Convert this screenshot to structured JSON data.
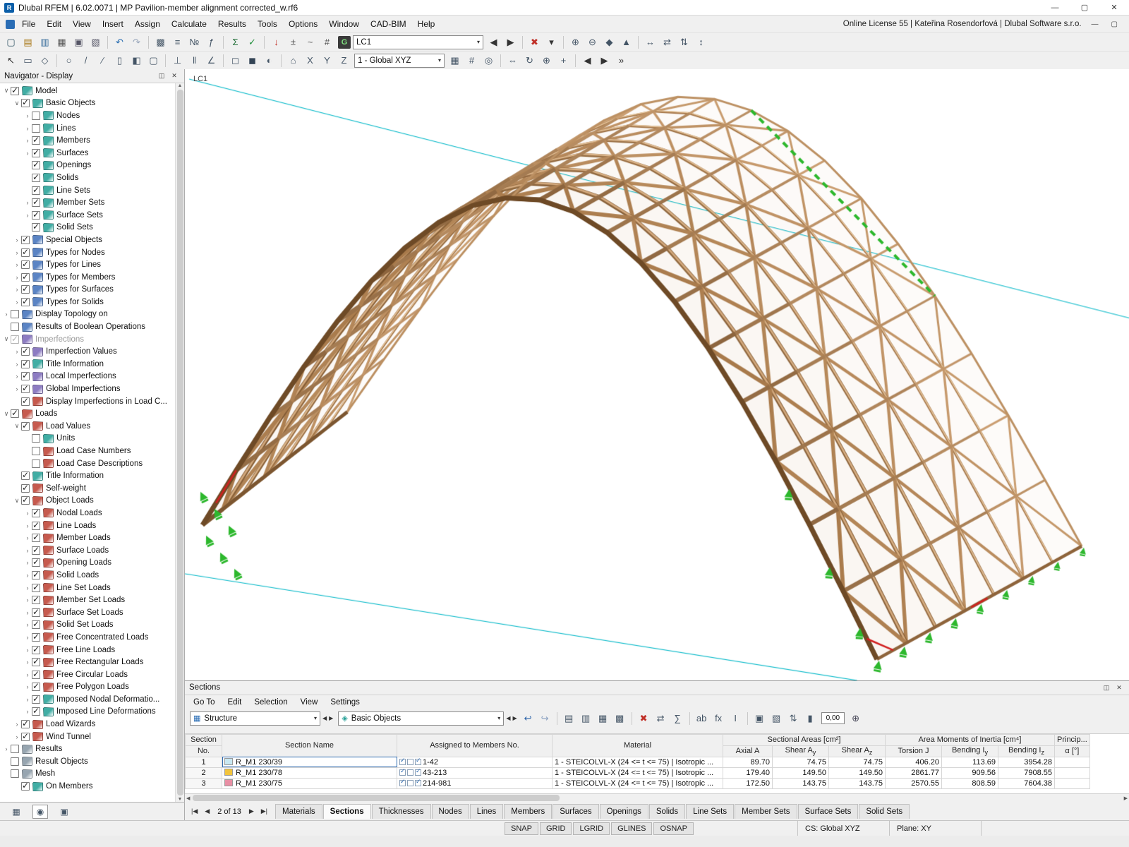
{
  "window": {
    "title": "Dlubal RFEM | 6.02.0071 | MP Pavilion-member alignment corrected_w.rf6"
  },
  "menu": {
    "items": [
      "File",
      "Edit",
      "View",
      "Insert",
      "Assign",
      "Calculate",
      "Results",
      "Tools",
      "Options",
      "Window",
      "CAD-BIM",
      "Help"
    ],
    "license": "Online License 55 | Kateřina Rosendorfová | Dlubal Software s.r.o."
  },
  "toolbar1": {
    "before": [
      [
        "new-model-icon",
        "▢",
        "#356"
      ],
      [
        "open-file-icon",
        "▤",
        "#a87818"
      ],
      [
        "save-file-icon",
        "▥",
        "#336a99"
      ],
      [
        "print-icon",
        "▦",
        "#555"
      ],
      [
        "copy-icon",
        "▣",
        "#556"
      ],
      [
        "screenshot-icon",
        "▧",
        "#556"
      ],
      [
        "sep"
      ],
      [
        "undo-icon",
        "↶",
        "#246ab0"
      ],
      [
        "redo-icon",
        "↷",
        "#95a3b9"
      ],
      [
        "sep"
      ],
      [
        "table-manager-icon",
        "▩",
        "#456"
      ],
      [
        "list-icon",
        "≡",
        "#456"
      ],
      [
        "renumber-icon",
        "№",
        "#456"
      ],
      [
        "generate-icon",
        "ƒ",
        "#456"
      ],
      [
        "sep"
      ],
      [
        "calculate-all-icon",
        "Σ",
        "#1f6e37"
      ],
      [
        "check-model-icon",
        "✓",
        "#1f8e3a"
      ],
      [
        "sep"
      ],
      [
        "new-load-icon",
        "↓",
        "#c03028"
      ],
      [
        "load-combination-icon",
        "±",
        "#555"
      ],
      [
        "imperfection-icon",
        "~",
        "#555"
      ],
      [
        "grid-icon",
        "#",
        "#555"
      ]
    ],
    "g_label": "G",
    "load_case": "LC1",
    "after": [
      [
        "prev-load-case-icon",
        "◀",
        "#333"
      ],
      [
        "next-load-case-icon",
        "▶",
        "#333"
      ],
      [
        "sep"
      ],
      [
        "delete-results-icon",
        "✖",
        "#c03028"
      ],
      [
        "delete-dropdown-icon",
        "▾",
        "#333"
      ],
      [
        "sep"
      ],
      [
        "zoom-in-icon",
        "⊕",
        "#456"
      ],
      [
        "zoom-out-icon",
        "⊖",
        "#456"
      ],
      [
        "node-snap-icon",
        "◆",
        "#456"
      ],
      [
        "member-snap-icon",
        "▲",
        "#456"
      ],
      [
        "sep"
      ],
      [
        "move-icon",
        "↔",
        "#456"
      ],
      [
        "swap-icon",
        "⇄",
        "#456"
      ],
      [
        "flip-icon",
        "⇅",
        "#456"
      ],
      [
        "measure-icon",
        "↕",
        "#456"
      ]
    ]
  },
  "toolbar2": {
    "before": [
      [
        "select-arrow-icon",
        "↖",
        "#333"
      ],
      [
        "select-window-icon",
        "▭",
        "#456"
      ],
      [
        "deselect-icon",
        "◇",
        "#456"
      ],
      [
        "sep"
      ],
      [
        "new-node-icon",
        "○",
        "#456"
      ],
      [
        "new-line-icon",
        "/",
        "#456"
      ],
      [
        "new-member-icon",
        "∕",
        "#456"
      ],
      [
        "new-surface-icon",
        "▯",
        "#456"
      ],
      [
        "new-solid-icon",
        "◧",
        "#456"
      ],
      [
        "new-opening-icon",
        "▢",
        "#456"
      ],
      [
        "sep"
      ],
      [
        "support-icon",
        "⊥",
        "#456"
      ],
      [
        "hinge-icon",
        "‖",
        "#456"
      ],
      [
        "dimension-icon",
        "∠",
        "#456"
      ],
      [
        "sep"
      ],
      [
        "wireframe-render-icon",
        "◻",
        "#456"
      ],
      [
        "solid-render-icon",
        "◼",
        "#345"
      ],
      [
        "transparent-render-icon",
        "◐",
        "#456"
      ],
      [
        "sep"
      ],
      [
        "isometric-view-icon",
        "⌂",
        "#456"
      ],
      [
        "view-x-icon",
        "X",
        "#456"
      ],
      [
        "view-y-icon",
        "Y",
        "#456"
      ],
      [
        "view-z-icon",
        "Z",
        "#456"
      ]
    ],
    "axis": "1 - Global XYZ",
    "after": [
      [
        "work-plane-icon",
        "▦",
        "#456"
      ],
      [
        "grid-toggle-icon",
        "#",
        "#456"
      ],
      [
        "snap-toggle-icon",
        "◎",
        "#456"
      ],
      [
        "sep"
      ],
      [
        "move-copy-icon",
        "⇔",
        "#456"
      ],
      [
        "rotate-view-icon",
        "↻",
        "#456"
      ],
      [
        "zoom-window-icon",
        "⊕",
        "#456"
      ],
      [
        "pan-icon",
        "+",
        "#456"
      ],
      [
        "sep"
      ],
      [
        "previous-view-icon",
        "◀",
        "#333"
      ],
      [
        "next-view-icon",
        "▶",
        "#333"
      ],
      [
        "more-tools-icon",
        "»",
        "#333"
      ]
    ]
  },
  "navigator": {
    "title": "Navigator - Display",
    "tree": [
      [
        "Model",
        0,
        "e",
        1,
        0
      ],
      [
        "Basic Objects",
        1,
        "e",
        1,
        0
      ],
      [
        "Nodes",
        2,
        "c",
        0,
        0
      ],
      [
        "Lines",
        2,
        "c",
        0,
        0
      ],
      [
        "Members",
        2,
        "c",
        1,
        0
      ],
      [
        "Surfaces",
        2,
        "c",
        1,
        0
      ],
      [
        "Openings",
        2,
        "",
        1,
        0
      ],
      [
        "Solids",
        2,
        "",
        1,
        0
      ],
      [
        "Line Sets",
        2,
        "",
        1,
        0
      ],
      [
        "Member Sets",
        2,
        "c",
        1,
        0
      ],
      [
        "Surface Sets",
        2,
        "c",
        1,
        0
      ],
      [
        "Solid Sets",
        2,
        "",
        1,
        0
      ],
      [
        "Special Objects",
        1,
        "c",
        1,
        0
      ],
      [
        "Types for Nodes",
        1,
        "c",
        1,
        0
      ],
      [
        "Types for Lines",
        1,
        "c",
        1,
        0
      ],
      [
        "Types for Members",
        1,
        "c",
        1,
        0
      ],
      [
        "Types for Surfaces",
        1,
        "c",
        1,
        0
      ],
      [
        "Types for Solids",
        1,
        "c",
        1,
        0
      ],
      [
        "Display Topology on",
        0,
        "c",
        0,
        0
      ],
      [
        "Results of Boolean Operations",
        0,
        "",
        0,
        0
      ],
      [
        "Imperfections",
        0,
        "e",
        1,
        1
      ],
      [
        "Imperfection Values",
        1,
        "c",
        1,
        0
      ],
      [
        "Title Information",
        1,
        "c",
        1,
        0
      ],
      [
        "Local Imperfections",
        1,
        "c",
        1,
        0
      ],
      [
        "Global Imperfections",
        1,
        "c",
        1,
        0
      ],
      [
        "Display Imperfections in Load C...",
        1,
        "",
        1,
        0
      ],
      [
        "Loads",
        0,
        "e",
        1,
        0
      ],
      [
        "Load Values",
        1,
        "e",
        1,
        0
      ],
      [
        "Units",
        2,
        "",
        0,
        0
      ],
      [
        "Load Case Numbers",
        2,
        "",
        0,
        0
      ],
      [
        "Load Case Descriptions",
        2,
        "",
        0,
        0
      ],
      [
        "Title Information",
        1,
        "",
        1,
        0
      ],
      [
        "Self-weight",
        1,
        "",
        1,
        0
      ],
      [
        "Object Loads",
        1,
        "e",
        1,
        0
      ],
      [
        "Nodal Loads",
        2,
        "c",
        1,
        0
      ],
      [
        "Line Loads",
        2,
        "c",
        1,
        0
      ],
      [
        "Member Loads",
        2,
        "c",
        1,
        0
      ],
      [
        "Surface Loads",
        2,
        "c",
        1,
        0
      ],
      [
        "Opening Loads",
        2,
        "c",
        1,
        0
      ],
      [
        "Solid Loads",
        2,
        "c",
        1,
        0
      ],
      [
        "Line Set Loads",
        2,
        "c",
        1,
        0
      ],
      [
        "Member Set Loads",
        2,
        "c",
        1,
        0
      ],
      [
        "Surface Set Loads",
        2,
        "c",
        1,
        0
      ],
      [
        "Solid Set Loads",
        2,
        "c",
        1,
        0
      ],
      [
        "Free Concentrated Loads",
        2,
        "c",
        1,
        0
      ],
      [
        "Free Line Loads",
        2,
        "c",
        1,
        0
      ],
      [
        "Free Rectangular Loads",
        2,
        "c",
        1,
        0
      ],
      [
        "Free Circular Loads",
        2,
        "c",
        1,
        0
      ],
      [
        "Free Polygon Loads",
        2,
        "c",
        1,
        0
      ],
      [
        "Imposed Nodal Deformatio...",
        2,
        "c",
        1,
        0
      ],
      [
        "Imposed Line Deformations",
        2,
        "c",
        1,
        0
      ],
      [
        "Load Wizards",
        1,
        "c",
        1,
        0
      ],
      [
        "Wind Tunnel",
        1,
        "c",
        1,
        0
      ],
      [
        "Results",
        0,
        "c",
        0,
        0
      ],
      [
        "Result Objects",
        0,
        "",
        0,
        0
      ],
      [
        "Mesh",
        0,
        "",
        0,
        0
      ],
      [
        "On Members",
        1,
        "",
        1,
        0
      ]
    ]
  },
  "viewport": {
    "label": "LC1",
    "colors": {
      "guide": "#00b8c8",
      "wood_light": "#cfa376",
      "wood_mid": "#a87a4b",
      "wood_dark": "#7c5630",
      "rim": "#6e4a26",
      "support": "#2db82d",
      "marker": "#d22020"
    }
  },
  "sections": {
    "title": "Sections",
    "menu": [
      "Go To",
      "Edit",
      "Selection",
      "View",
      "Settings"
    ],
    "combo_structure": "Structure",
    "combo_objects": "Basic Objects",
    "readout": "0,00",
    "toolbar_icons": [
      [
        "jump-back-icon",
        "↩",
        "#2a62a8"
      ],
      [
        "jump-forward-icon",
        "↪",
        "#8aa0c0"
      ],
      [
        "sep"
      ],
      [
        "table-view-icon",
        "▤",
        "#456"
      ],
      [
        "result-view-icon",
        "▥",
        "#456"
      ],
      [
        "filter-view-icon",
        "▦",
        "#456"
      ],
      [
        "settings-view-icon",
        "▩",
        "#456"
      ],
      [
        "sep"
      ],
      [
        "delete-row-icon",
        "✖",
        "#c03028"
      ],
      [
        "exchange-icon",
        "⇄",
        "#456"
      ],
      [
        "sum-icon",
        "∑",
        "#456"
      ],
      [
        "sep"
      ],
      [
        "rename-icon",
        "ab",
        "#456"
      ],
      [
        "function-icon",
        "fx",
        "#456"
      ],
      [
        "format-icon",
        "I",
        "#456"
      ],
      [
        "sep"
      ],
      [
        "print-table-icon",
        "▣",
        "#456"
      ],
      [
        "calendar-icon",
        "▧",
        "#456"
      ],
      [
        "import-export-icon",
        "⇅",
        "#456"
      ],
      [
        "chart-icon",
        "▮",
        "#456"
      ]
    ],
    "table": {
      "corner": "Section",
      "no_label": "No.",
      "name_label": "Section Name",
      "members_label": "Assigned to Members No.",
      "material_label": "Material",
      "groups": {
        "areas": "Sectional Areas [cm²]",
        "inertia": "Area Moments of Inertia [cm⁴]",
        "principal": "Princip..."
      },
      "cols": [
        "Axial A",
        "Shear A_y",
        "Shear A_z",
        "Torsion J",
        "Bending I_y",
        "Bending I_z",
        "α [°]"
      ],
      "rows": [
        {
          "no": "1",
          "chip": "#c9e8f2",
          "name": "R_M1 230/39",
          "members": "1-42",
          "material": "1 - STEICOLVL-X (24 <= t <= 75) | Isotropic ...",
          "values": [
            "89.70",
            "74.75",
            "74.75",
            "406.20",
            "113.69",
            "3954.28"
          ],
          "selected": true
        },
        {
          "no": "2",
          "chip": "#f2c43c",
          "name": "R_M1 230/78",
          "members": "43-213",
          "material": "1 - STEICOLVL-X (24 <= t <= 75) | Isotropic ...",
          "values": [
            "179.40",
            "149.50",
            "149.50",
            "2861.77",
            "909.56",
            "7908.55"
          ],
          "selected": false
        },
        {
          "no": "3",
          "chip": "#e88fa4",
          "name": "R_M1 230/75",
          "members": "214-981",
          "material": "1 - STEICOLVL-X (24 <= t <= 75) | Isotropic ...",
          "values": [
            "172.50",
            "143.75",
            "143.75",
            "2570.55",
            "808.59",
            "7604.38"
          ],
          "selected": false
        }
      ]
    }
  },
  "tabs": {
    "position": "2 of 13",
    "items": [
      "Materials",
      "Sections",
      "Thicknesses",
      "Nodes",
      "Lines",
      "Members",
      "Surfaces",
      "Openings",
      "Solids",
      "Line Sets",
      "Member Sets",
      "Surface Sets",
      "Solid Sets"
    ],
    "active": "Sections"
  },
  "status": {
    "buttons": [
      "SNAP",
      "GRID",
      "LGRID",
      "GLINES",
      "OSNAP"
    ],
    "cs": "CS: Global XYZ",
    "plane": "Plane: XY"
  }
}
